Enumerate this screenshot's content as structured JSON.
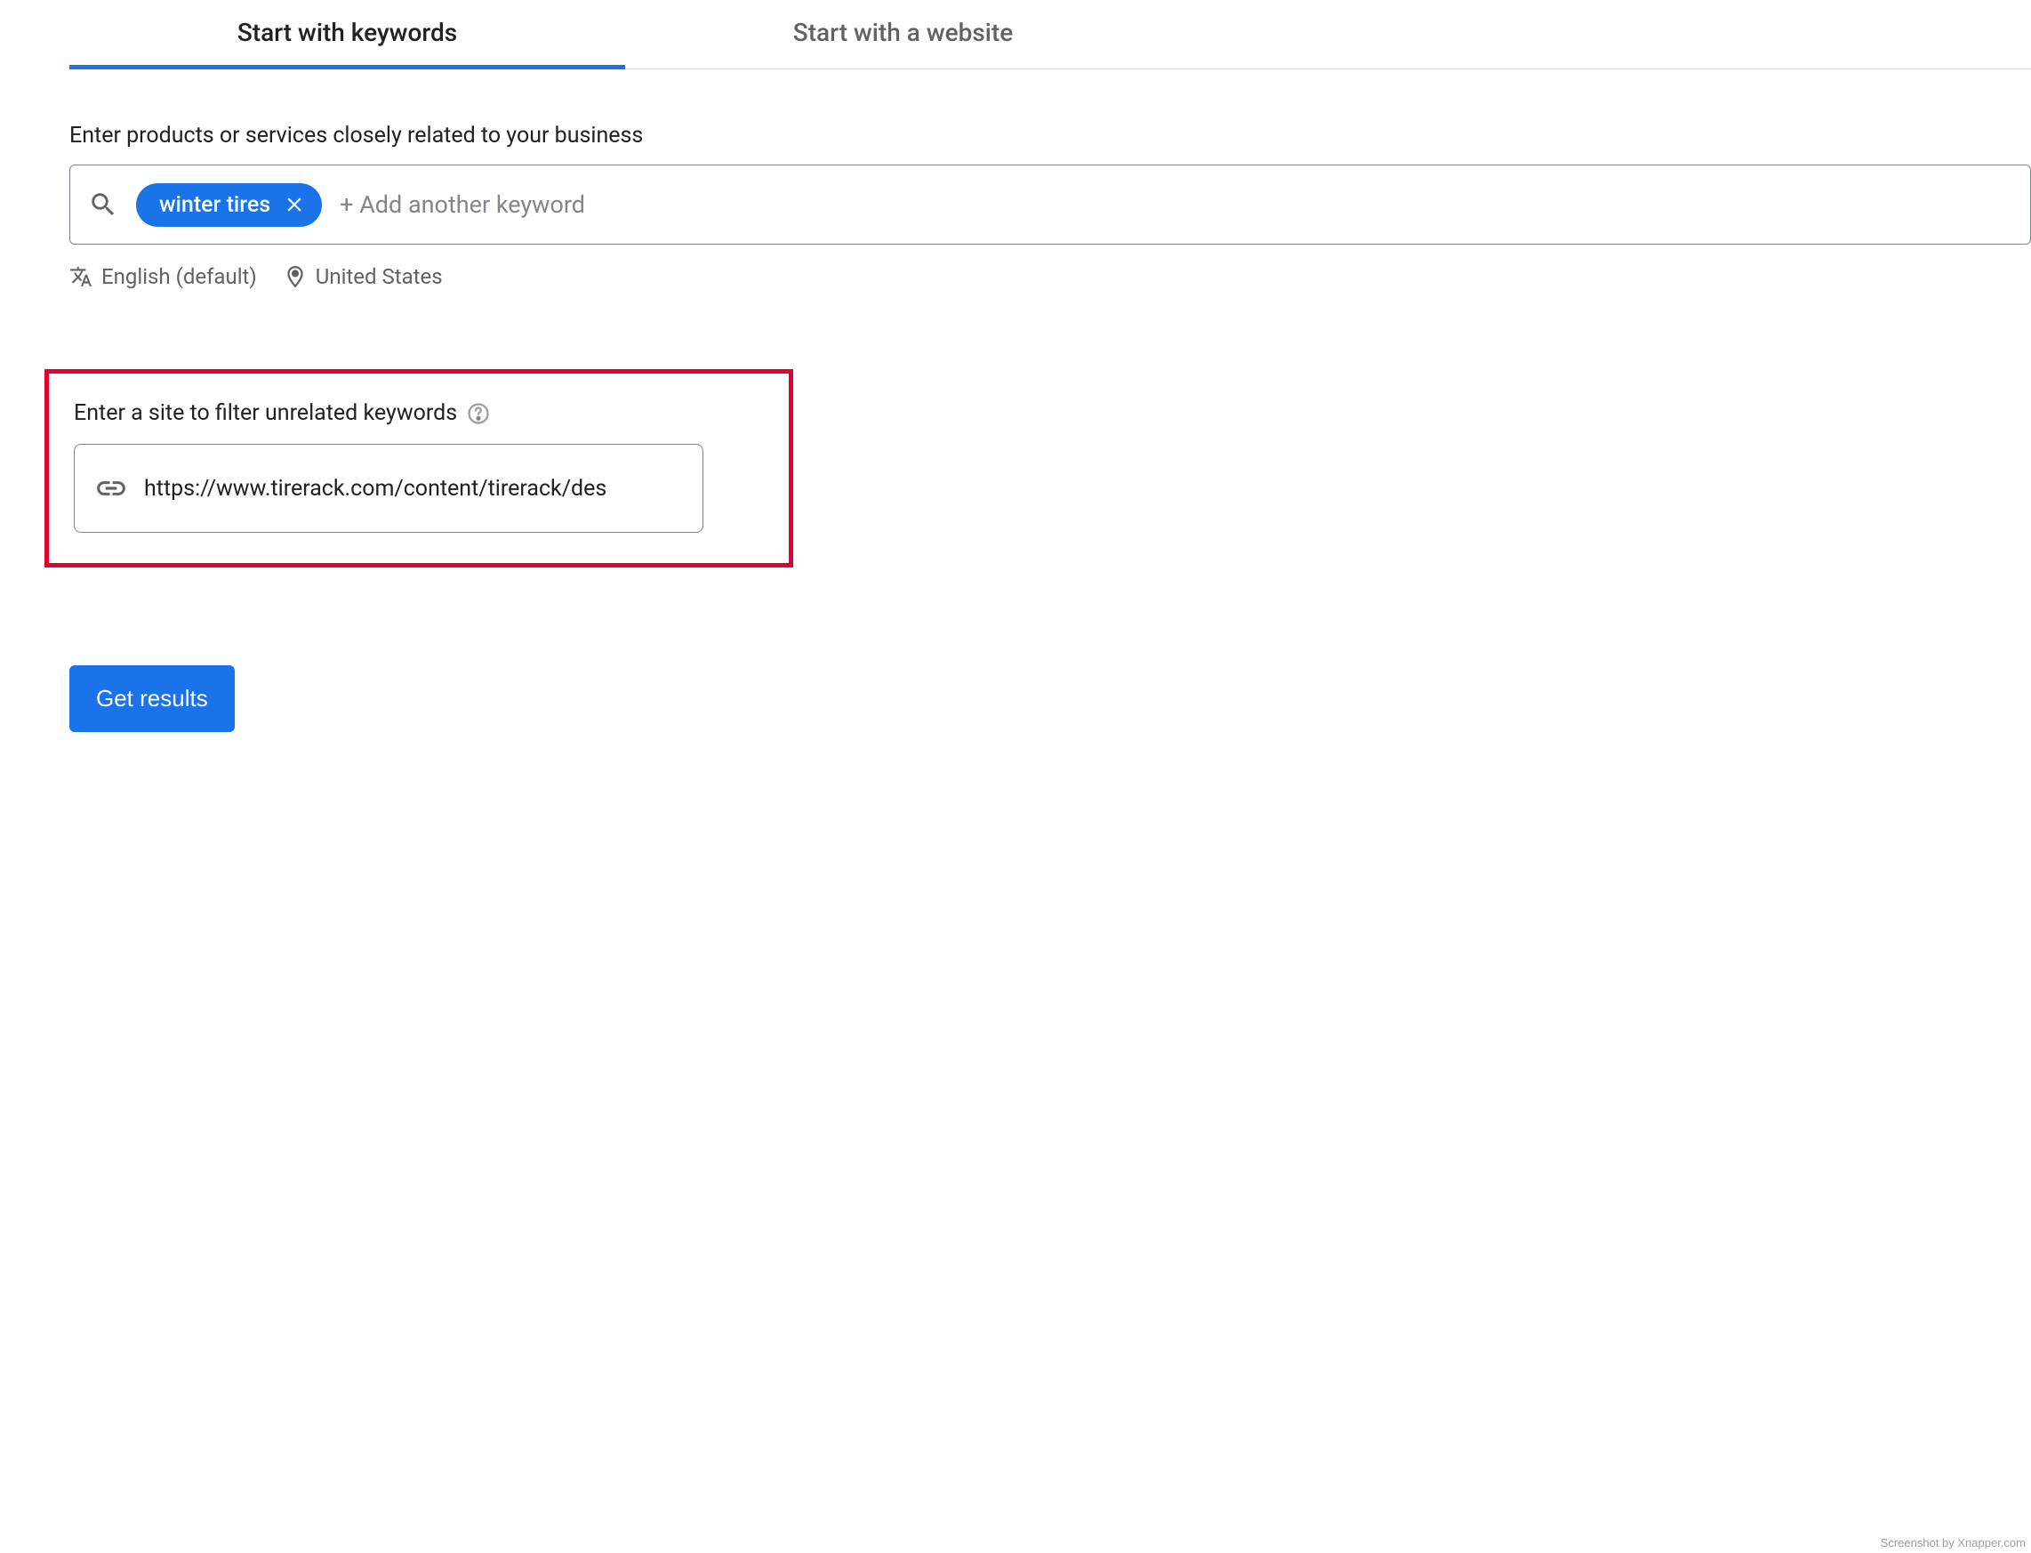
{
  "tabs": {
    "keywords": "Start with keywords",
    "website": "Start with a website"
  },
  "keyword_section": {
    "label": "Enter products or services closely related to your business",
    "chip_text": "winter tires",
    "add_placeholder": "+ Add another keyword"
  },
  "meta": {
    "language": "English (default)",
    "location": "United States"
  },
  "filter_section": {
    "label": "Enter a site to filter unrelated keywords",
    "url_value": "https://www.tirerack.com/content/tirerack/des"
  },
  "actions": {
    "get_results": "Get results"
  },
  "watermark": "Screenshot by Xnapper.com"
}
